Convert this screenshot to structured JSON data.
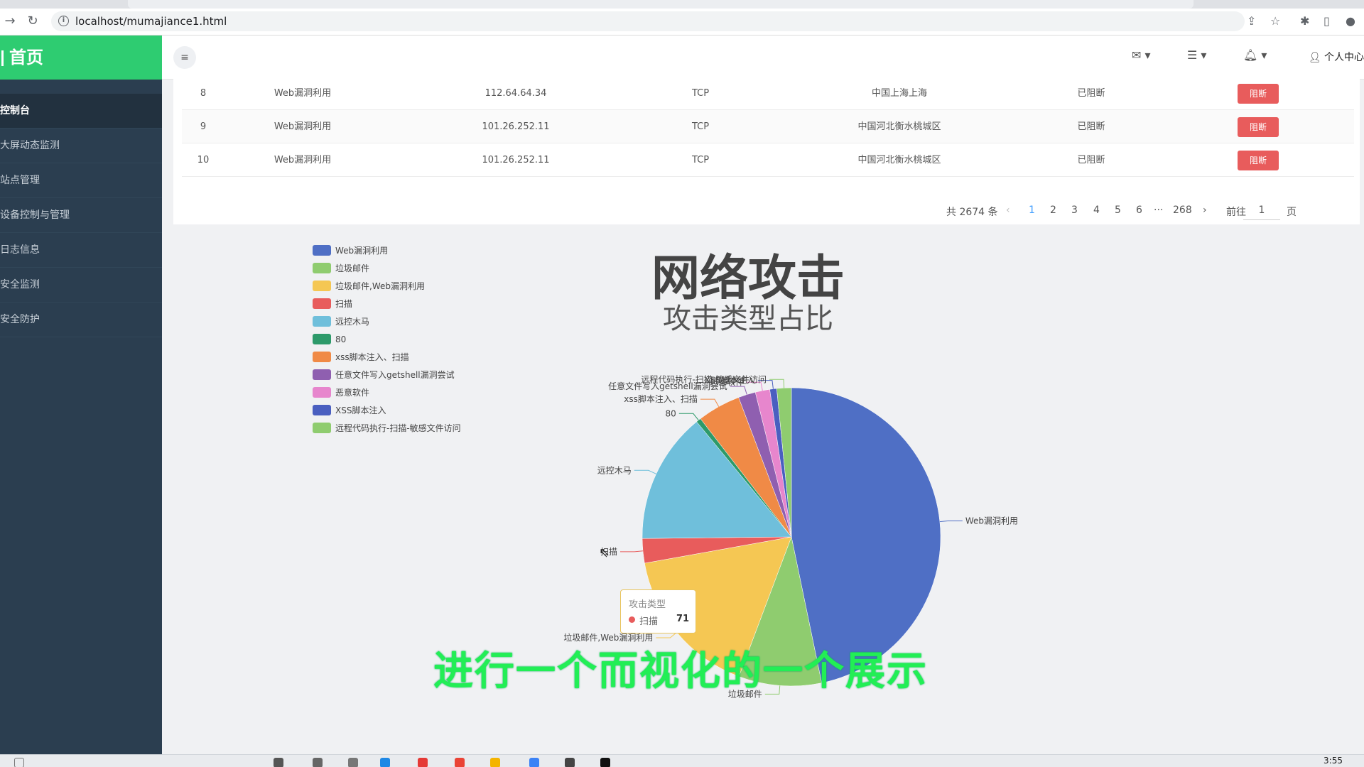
{
  "browser": {
    "url": "localhost/mumajiance1.html"
  },
  "sidebar": {
    "brand": "首页",
    "items": [
      {
        "label": "控制台",
        "active": true
      },
      {
        "label": "大屏动态监测"
      },
      {
        "label": "站点管理"
      },
      {
        "label": "设备控制与管理"
      },
      {
        "label": "日志信息"
      },
      {
        "label": "安全监测"
      },
      {
        "label": "安全防护"
      }
    ]
  },
  "header": {
    "user_label": "个人中心"
  },
  "table": {
    "rows": [
      {
        "index": "8",
        "type": "Web漏洞利用",
        "ip": "112.64.64.34",
        "protocol": "TCP",
        "location": "中国上海上海",
        "status": "已阻断",
        "action": "阻断"
      },
      {
        "index": "9",
        "type": "Web漏洞利用",
        "ip": "101.26.252.11",
        "protocol": "TCP",
        "location": "中国河北衡水桃城区",
        "status": "已阻断",
        "action": "阻断"
      },
      {
        "index": "10",
        "type": "Web漏洞利用",
        "ip": "101.26.252.11",
        "protocol": "TCP",
        "location": "中国河北衡水桃城区",
        "status": "已阻断",
        "action": "阻断"
      }
    ],
    "pagination": {
      "total": "共 2674 条",
      "pages": [
        "1",
        "2",
        "3",
        "4",
        "5",
        "6",
        "···",
        "268"
      ],
      "goto_prefix": "前往",
      "goto_value": "1",
      "goto_suffix": "页"
    }
  },
  "chart_data": {
    "type": "pie",
    "title": "网络攻击",
    "subtitle": "攻击类型占比",
    "legend_position": "top-left",
    "series_name": "攻击类型",
    "slices": [
      {
        "name": "Web漏洞利用",
        "value": 1250,
        "color": "#4f6fc5"
      },
      {
        "name": "垃圾邮件",
        "value": 240,
        "color": "#8fcc6f"
      },
      {
        "name": "垃圾邮件,Web漏洞利用",
        "value": 440,
        "color": "#f5c753"
      },
      {
        "name": "扫描",
        "value": 71,
        "color": "#e85c5c"
      },
      {
        "name": "远控木马",
        "value": 380,
        "color": "#6fbfdb"
      },
      {
        "name": "80",
        "value": 14,
        "color": "#2d9a6a"
      },
      {
        "name": "xss脚本注入、扫描",
        "value": 125,
        "color": "#f08a46"
      },
      {
        "name": "任意文件写入getshell漏洞尝试",
        "value": 50,
        "color": "#8f5fb0"
      },
      {
        "name": "恶意软件",
        "value": 42,
        "color": "#e786cd"
      },
      {
        "name": "XSS脚本注入",
        "value": 20,
        "color": "#4a5fc0"
      },
      {
        "name": "远程代码执行-扫描-敏感文件访问",
        "value": 42,
        "color": "#8fcc6f"
      }
    ],
    "tooltip": {
      "title": "攻击类型",
      "name": "扫描",
      "value": "71"
    }
  },
  "caption": "进行一个而视化的一个展示",
  "taskbar": {
    "clock": "3:55"
  }
}
